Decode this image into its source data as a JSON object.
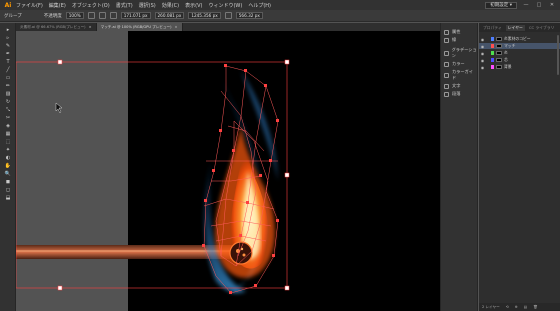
{
  "app": {
    "logo": "Ai",
    "brand_color": "#ff9a00"
  },
  "menu": {
    "items": [
      "ファイル(F)",
      "編集(E)",
      "オブジェクト(O)",
      "書式(T)",
      "選択(S)",
      "効果(C)",
      "表示(V)",
      "ウィンドウ(W)",
      "ヘルプ(H)"
    ],
    "workspace": "初期設定 ▾",
    "window_buttons": [
      "—",
      "□",
      "✕"
    ]
  },
  "control": {
    "selection_label": "グループ",
    "stroke_label": "不透明度",
    "opacity_value": "100%",
    "x_value": "171.071 px",
    "y_value": "260.081 px",
    "w_value": "1245.356 px",
    "h_value": "566.32 px"
  },
  "tabs": [
    {
      "label": "炎素材.ai @ 66.67% (RGB/プレビュー)",
      "active": false
    },
    {
      "label": "マッチ.ai @ 100% (RGB/GPU プレビュー)",
      "active": true
    }
  ],
  "tools": [
    "▸",
    "▹",
    "✎",
    "✒",
    "T",
    "╱",
    "▭",
    "✏",
    "▨",
    "↻",
    "⤡",
    "✂",
    "◈",
    "▦",
    "⬚",
    "✦",
    "◐",
    "✋",
    "🔍",
    "◼",
    "◻",
    "⬓"
  ],
  "dock": [
    {
      "label": "属性",
      "icon": "attributes-icon"
    },
    {
      "label": "線",
      "icon": "stroke-icon"
    },
    {
      "label": "グラデーション",
      "icon": "gradient-icon"
    },
    {
      "label": "カラー",
      "icon": "color-icon"
    },
    {
      "label": "カラーガイド",
      "icon": "color-guide-icon"
    },
    {
      "label": "文字",
      "icon": "character-icon"
    },
    {
      "label": "段落",
      "icon": "paragraph-icon"
    }
  ],
  "layers_panel": {
    "tabs": [
      "プロパティ",
      "レイヤー",
      "CC ライブラリ"
    ],
    "active_tab": 1,
    "rows": [
      {
        "name": "炎素材のコピー",
        "color": "#4f7fff",
        "selected": false
      },
      {
        "name": "マッチ",
        "color": "#ff4f4f",
        "selected": true
      },
      {
        "name": "炎",
        "color": "#4fdf4f",
        "selected": false
      },
      {
        "name": "芯",
        "color": "#4f4fff",
        "selected": false
      },
      {
        "name": "背景",
        "color": "#ff4fff",
        "selected": false
      }
    ],
    "footer": [
      "2 レイヤー",
      "⟲",
      "⊕",
      "▤",
      "🗑"
    ]
  },
  "artwork": {
    "artboard_color": "#000000",
    "selection_color": "#ff5a5a",
    "match_stick_color": "#c8643c",
    "flame_core": "#fff2c0",
    "flame_mid": "#ff8a1a",
    "flame_outer": "#3a8bd6"
  }
}
